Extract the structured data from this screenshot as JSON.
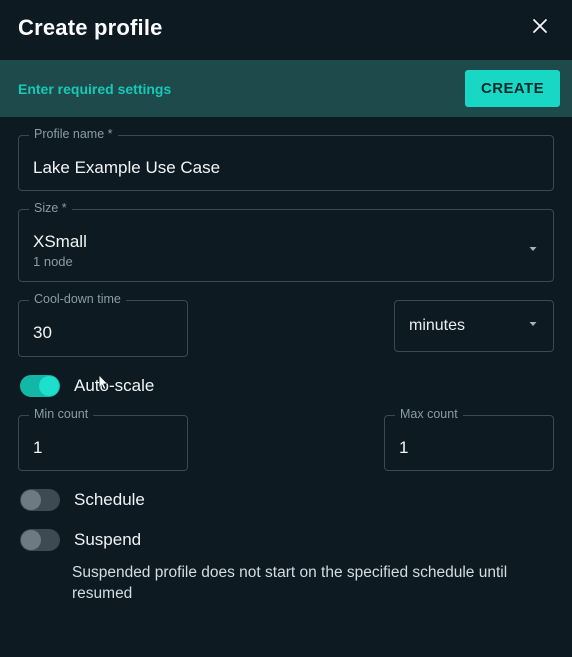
{
  "header": {
    "title": "Create profile"
  },
  "banner": {
    "message": "Enter required settings",
    "button": "CREATE"
  },
  "fields": {
    "profile_name": {
      "label": "Profile name *",
      "value": "Lake Example Use Case"
    },
    "size": {
      "label": "Size *",
      "value": "XSmall",
      "sub": "1 node"
    },
    "cooldown": {
      "label": "Cool-down time",
      "value": "30",
      "unit": "minutes"
    },
    "autoscale": {
      "label": "Auto-scale",
      "on": true,
      "min_label": "Min count",
      "min_value": "1",
      "max_label": "Max count",
      "max_value": "1"
    },
    "schedule": {
      "label": "Schedule",
      "on": false
    },
    "suspend": {
      "label": "Suspend",
      "on": false,
      "desc": "Suspended profile does not start on the specified schedule until resumed"
    }
  }
}
